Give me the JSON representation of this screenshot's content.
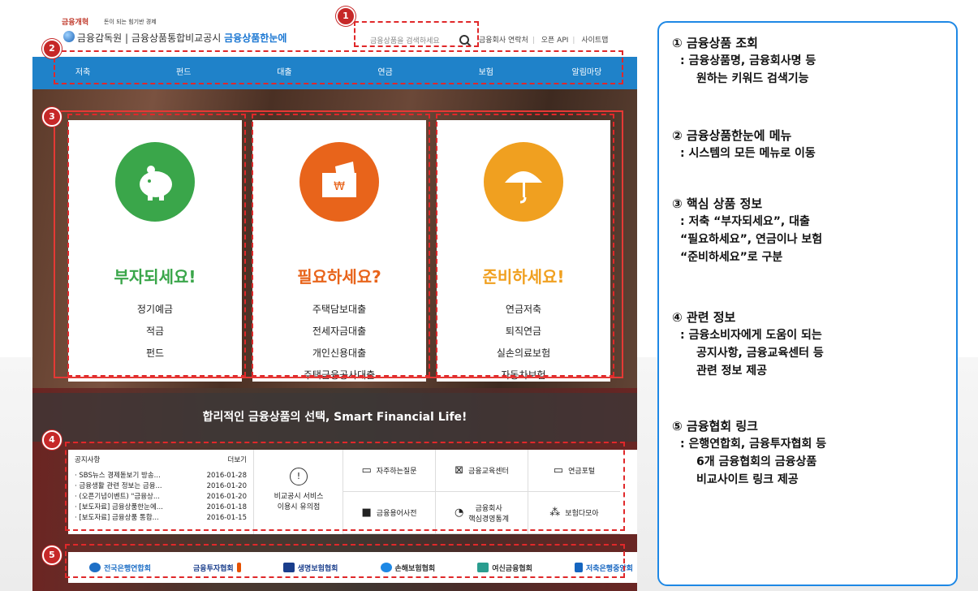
{
  "header": {
    "logo_small": "금융개혁",
    "logo_tagline": "돈이 되는 힘기반 경제",
    "title_part1": "금융감독원",
    "title_sep": "|",
    "title_part2": "금융상품통합비교공시",
    "brand": "금융상품한눈에",
    "search_placeholder": "금융상품을 검색하세요",
    "links": [
      "금융회사 연락처",
      "오픈 API",
      "사이트맵"
    ]
  },
  "nav": [
    "저축",
    "펀드",
    "대출",
    "연금",
    "보험",
    "알림마당"
  ],
  "cards": [
    {
      "title": "부자되세요!",
      "items": [
        "정기예금",
        "적금",
        "펀드"
      ],
      "color": "#3aa64a",
      "icon": "piggy-bank-icon"
    },
    {
      "title": "필요하세요?",
      "items": [
        "주택담보대출",
        "전세자금대출",
        "개인신용대출",
        "주택금융공사대출"
      ],
      "color": "#e8641b",
      "icon": "won-envelope-icon"
    },
    {
      "title": "준비하세요!",
      "items": [
        "연금저축",
        "퇴직연금",
        "실손의료보험",
        "자동차보험"
      ],
      "color": "#f0a020",
      "icon": "umbrella-icon"
    }
  ],
  "band_text": "합리적인 금융상품의 선택, Smart Financial Life!",
  "notice": {
    "title": "공지사항",
    "more": "더보기",
    "rows": [
      {
        "text": "· SBS뉴스 경제돋보기 방송...",
        "date": "2016-01-28"
      },
      {
        "text": "· 금융생활 관련 정보는 금융...",
        "date": "2016-01-20"
      },
      {
        "text": "· (오픈기념이벤트) \"금융상...",
        "date": "2016-01-20"
      },
      {
        "text": "· [보도자료] 금융상품한눈에...",
        "date": "2016-01-18"
      },
      {
        "text": "· [보도자료] 금융상품 통합...",
        "date": "2016-01-15"
      }
    ]
  },
  "guide": {
    "line1": "비교공시 서비스",
    "line2": "이용시 유의점"
  },
  "tiles": [
    {
      "label": "자주하는질문",
      "icon": "chat-icon"
    },
    {
      "label": "금융교육센터",
      "icon": "presentation-icon"
    },
    {
      "label": "연금포털",
      "icon": "monitor-icon"
    },
    {
      "label": "금융용어사전",
      "icon": "book-icon"
    },
    {
      "label": "금융회사\n핵심경영통계",
      "icon": "pie-chart-icon"
    },
    {
      "label": "보험다모아",
      "icon": "group-icon"
    }
  ],
  "associations": [
    {
      "label": "전국은행연합회",
      "color": "#1e6fc6"
    },
    {
      "label": "금융투자협회",
      "color": "#e65100"
    },
    {
      "label": "생명보험협회",
      "color": "#1a3e8c"
    },
    {
      "label": "손해보험협회",
      "color": "#1e88e5"
    },
    {
      "label": "여신금융협회",
      "color": "#2a9d8f"
    },
    {
      "label": "저축은행중앙회",
      "color": "#1565c0"
    }
  ],
  "badges": [
    "1",
    "2",
    "3",
    "4",
    "5"
  ],
  "panel": [
    {
      "title": "① 금융상품 조회",
      "lines": [
        ": 금융상품명, 금융회사명 등",
        "원하는 키워드 검색기능"
      ]
    },
    {
      "title": "② 금융상품한눈에 메뉴",
      "lines": [
        ": 시스템의 모든 메뉴로 이동"
      ]
    },
    {
      "title": "③ 핵심 상품 정보",
      "lines": [
        ": 저축 “부자되세요”,  대출",
        "“필요하세요”, 연금이나 보험",
        "“준비하세요”로 구분"
      ]
    },
    {
      "title": "④ 관련 정보",
      "lines": [
        ": 금융소비자에게 도움이 되는",
        "공지사항, 금융교육센터 등",
        "관련 정보 제공"
      ]
    },
    {
      "title": "⑤ 금융협회 링크",
      "lines": [
        ": 은행연합회, 금융투자협회 등",
        "6개 금융협회의 금융상품",
        "비교사이트 링크 제공"
      ]
    }
  ],
  "colors": {
    "accent_red": "#e53935",
    "nav_blue": "#1f82c9",
    "panel_border": "#1e88e5"
  }
}
